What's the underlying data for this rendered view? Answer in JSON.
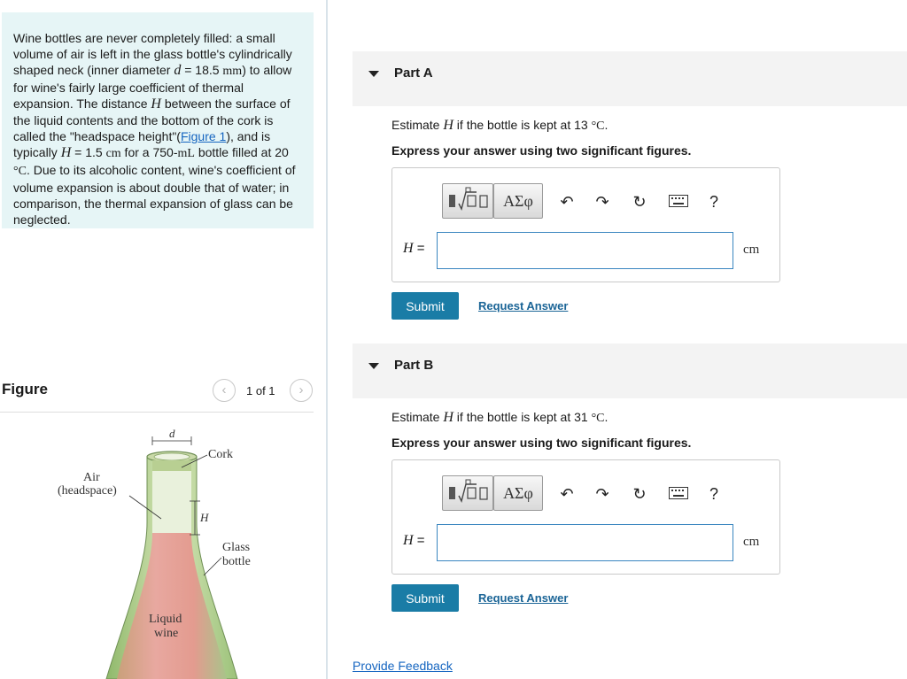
{
  "problem": {
    "text_1": "Wine bottles are never completely filled: a small volume of air is left in the glass bottle's cylindrically shaped neck (inner diameter ",
    "var_d": "d",
    "text_2": " = 18.5 ",
    "unit_mm": "mm",
    "text_3": ") to allow for wine's fairly large coefficient of thermal expansion. The distance ",
    "var_H": "H",
    "text_4": " between the surface of the liquid contents and the bottom of the cork is called the \"headspace height\"(",
    "figure_link": "Figure 1",
    "text_5": "), and is typically ",
    "var_H2": "H",
    "text_6": " = 1.5 ",
    "unit_cm": "cm",
    "text_7": " for a 750-",
    "unit_mL": "mL",
    "text_8": " bottle filled at 20 ",
    "unit_degC": "°C",
    "text_9": ". Due to its alcoholic content, wine's coefficient of volume expansion is about double that of water; in comparison, the thermal expansion of glass can be neglected."
  },
  "figure": {
    "title": "Figure",
    "pager": "1 of 1",
    "prev_icon": "chevron-left-icon",
    "next_icon": "chevron-right-icon",
    "labels": {
      "d": "d",
      "cork": "Cork",
      "air_1": "Air",
      "air_2": "(headspace)",
      "H": "H",
      "glass_1": "Glass",
      "glass_2": "bottle",
      "liquid_1": "Liquid",
      "liquid_2": "wine"
    }
  },
  "parts": [
    {
      "title": "Part A",
      "question_pre": "Estimate ",
      "question_var": "H",
      "question_mid": " if the bottle is kept at 13 ",
      "question_unit": "°C",
      "question_end": ".",
      "instruction": "Express your answer using two significant figures.",
      "answer_label": "H",
      "answer_eq": " =",
      "answer_value": "",
      "unit": "cm",
      "greek_label": "ΑΣφ",
      "submit": "Submit",
      "request": "Request Answer"
    },
    {
      "title": "Part B",
      "question_pre": "Estimate ",
      "question_var": "H",
      "question_mid": " if the bottle is kept at 31 ",
      "question_unit": "°C",
      "question_end": ".",
      "instruction": "Express your answer using two significant figures.",
      "answer_label": "H",
      "answer_eq": " =",
      "answer_value": "",
      "unit": "cm",
      "greek_label": "ΑΣφ",
      "submit": "Submit",
      "request": "Request Answer"
    }
  ],
  "toolbar": {
    "icons": [
      "templates-icon",
      "undo-icon",
      "redo-icon",
      "reset-icon",
      "keyboard-icon",
      "help-icon"
    ],
    "help_glyph": "?"
  },
  "footer": {
    "feedback": "Provide Feedback"
  }
}
